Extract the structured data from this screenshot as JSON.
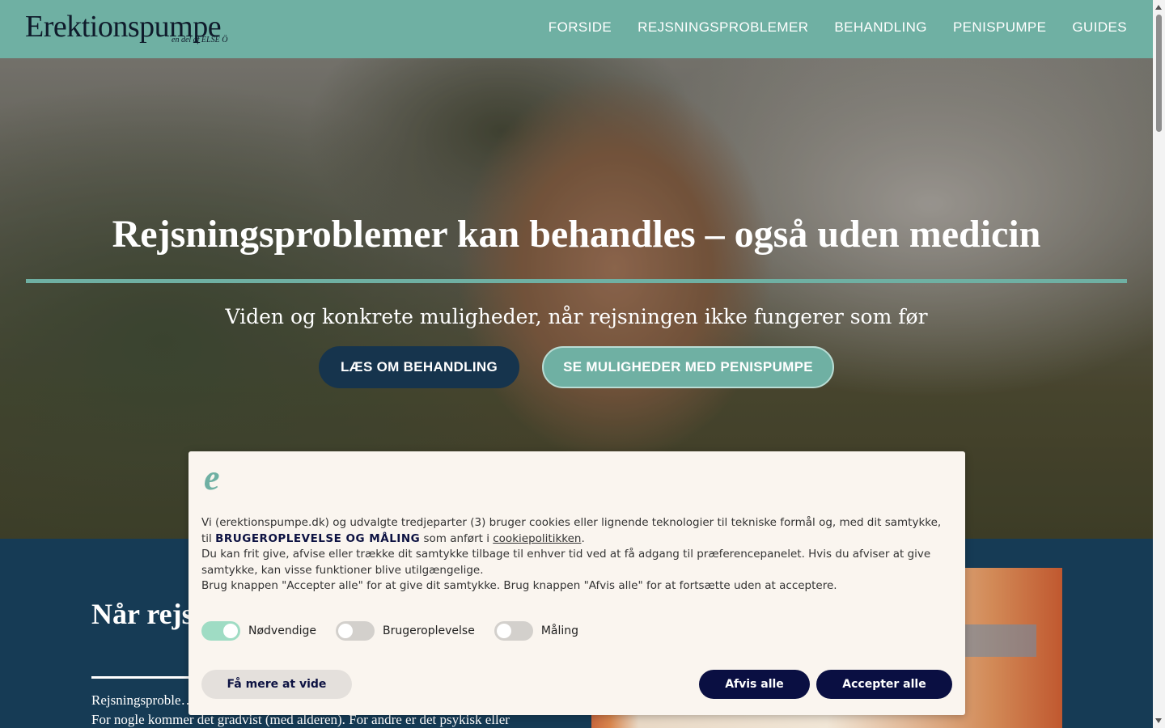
{
  "header": {
    "logo": {
      "name": "Erektionspumpe",
      "tagline": "en del af ELSE Ö"
    },
    "nav": [
      "FORSIDE",
      "REJSNINGSPROBLEMER",
      "BEHANDLING",
      "PENISPUMPE",
      "GUIDES"
    ]
  },
  "hero": {
    "title": "Rejsningsproblemer kan behandles – også uden medicin",
    "subtitle": "Viden og konkrete muligheder, når rejsningen ikke fungerer som før",
    "button_primary": "LÆS OM BEHANDLING",
    "button_secondary": "SE MULIGHEDER MED PENISPUMPE"
  },
  "section": {
    "title": "Når rejs… er som …",
    "text_line1": "Rejsningsproble…",
    "text_line2": "For nogle kommer det gradvist (med alderen). For andre er det psykisk eller"
  },
  "cookie": {
    "logo": "e",
    "p1_before": "Vi (erektionspumpe.dk) og udvalgte tredjeparter (3) bruger cookies eller lignende teknologier til tekniske formål og, med dit samtykke, til ",
    "p1_bold": "BRUGEROPLEVELSE OG MÅLING",
    "p1_middle": " som anført i ",
    "p1_link": "cookiepolitikken",
    "p1_after": ".",
    "p2": "Du kan frit give, afvise eller trække dit samtykke tilbage til enhver tid ved at få adgang til præferencepanelet. Hvis du afviser at give samtykke, kan visse funktioner blive utilgængelige.",
    "p3": "Brug knappen \"Accepter alle\" for at give dit samtykke. Brug knappen \"Afvis alle\" for at fortsætte uden at acceptere.",
    "toggles": [
      {
        "label": "Nødvendige",
        "state": "on"
      },
      {
        "label": "Brugeroplevelse",
        "state": "off"
      },
      {
        "label": "Måling",
        "state": "off"
      }
    ],
    "button_more": "Få mere at vide",
    "button_reject": "Afvis alle",
    "button_accept": "Accepter alle"
  },
  "colors": {
    "header_teal": "#6fb0a3",
    "navy": "#16344d",
    "cookie_button": "#0a0f42",
    "cookie_bg": "#faf5ef"
  }
}
